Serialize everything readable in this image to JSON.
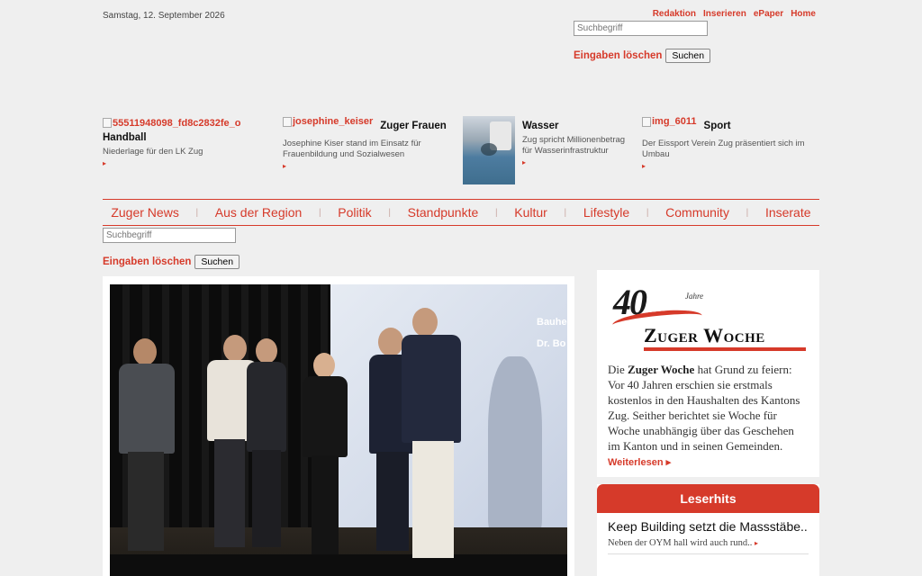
{
  "header": {
    "date": "Samstag, 12. September 2026",
    "links": [
      "Redaktion",
      "Inserieren",
      "ePaper",
      "Home"
    ]
  },
  "search": {
    "placeholder": "Suchbegriff",
    "clear_label": "Eingaben löschen",
    "submit_label": "Suchen"
  },
  "teasers": [
    {
      "img_alt": "55511948098_fd8c2832fe_o",
      "title": "Handball",
      "desc": "Niederlage für den LK Zug",
      "arrow": "▸"
    },
    {
      "img_alt": "josephine_keiser",
      "title": "Zuger Frauen",
      "desc": "Josephine Kiser stand im Einsatz für Frauenbildung und Sozialwesen",
      "arrow": "▸"
    },
    {
      "img_alt": "",
      "title": "Wasser",
      "desc": "Zug spricht Millionenbetrag für Wasserinfrastruktur",
      "arrow": "▸"
    },
    {
      "img_alt": "img_6011",
      "title": "Sport",
      "desc": "Der Eissport Verein Zug präsentiert sich im Umbau",
      "arrow": "▸"
    }
  ],
  "nav": {
    "items": [
      "Zuger News",
      "Aus der Region",
      "Politik",
      "Standpunkte",
      "Kultur",
      "Lifestyle",
      "Community",
      "Inserate"
    ],
    "separator": "|"
  },
  "hero": {
    "screen_lines": [
      "Bauhe",
      "Dr. Bo"
    ]
  },
  "sidebar": {
    "logo_number": "40",
    "logo_jahre": "Jahre",
    "logo_name": "Zuger Woche",
    "text_pre": "Die ",
    "text_bold": "Zuger Woche",
    "text_post": " hat Grund zu feiern: Vor 40 Jahren erschien sie erstmals kostenlos in den Haushalten des Kantons Zug. Seither berichtet sie Woche für Woche unabhängig über das Geschehen im Kanton und in seinen Gemeinden. ",
    "more_label": "Weiterlesen ▸"
  },
  "leserhits": {
    "title": "Leserhits",
    "items": [
      {
        "title": "Keep Building setzt die Massstäbe..",
        "desc": "Neben der OYM hall wird auch rund..",
        "arrow": "▸"
      }
    ]
  },
  "colors": {
    "accent": "#d63a2a",
    "background": "#efefef"
  }
}
